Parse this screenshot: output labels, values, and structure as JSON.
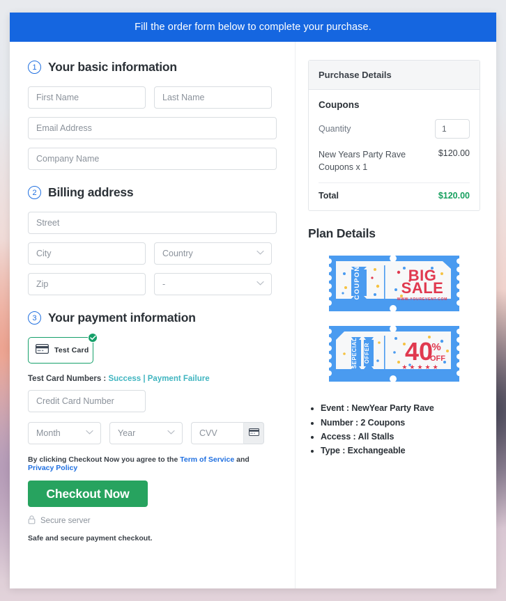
{
  "banner": {
    "text": "Fill the order form below to complete your purchase."
  },
  "sections": {
    "basic": {
      "number": "1",
      "title": "Your basic information",
      "fields": {
        "first_name": "First Name",
        "last_name": "Last Name",
        "email": "Email Address",
        "company": "Company Name"
      }
    },
    "billing": {
      "number": "2",
      "title": "Billing address",
      "fields": {
        "street": "Street",
        "city": "City",
        "country": "Country",
        "zip": "Zip",
        "state": "-"
      }
    },
    "payment": {
      "number": "3",
      "title": "Your payment information",
      "method": {
        "label": "Test  Card",
        "selected": true,
        "icon": "credit-card-icon",
        "check_icon": "check-circle-icon"
      },
      "test_numbers": {
        "prefix": "Test Card Numbers : ",
        "success": "Success",
        "separator": " | ",
        "failure": "Payment Failure"
      },
      "fields": {
        "card_number": "Credit Card Number",
        "month": "Month",
        "year": "Year",
        "cvv": "CVV"
      },
      "cvv_icon": "credit-card-icon",
      "terms": {
        "before": "By clicking Checkout Now you agree to the ",
        "tos": "Term of Service",
        "middle": " and ",
        "privacy": "Privacy Policy"
      },
      "checkout_label": "Checkout Now",
      "secure_label": "Secure server",
      "secure_icon": "lock-icon",
      "safe_note": "Safe and secure payment checkout."
    }
  },
  "purchase_details": {
    "heading": "Purchase Details",
    "subheading": "Coupons",
    "quantity_label": "Quantity",
    "quantity_value": "1",
    "line_item": {
      "name": "New Years Party Rave Coupons x 1",
      "price": "$120.00"
    },
    "total_label": "Total",
    "total_value": "$120.00"
  },
  "plan_details": {
    "title": "Plan Details",
    "tickets": [
      {
        "tab": "COUPON",
        "headline_top": "BIG",
        "headline_bottom": "SALE",
        "url": "WWW.YOUREVENT.COM"
      },
      {
        "tab_top": "SEPECIAL",
        "tab_bottom": "OFFER",
        "amount": "40",
        "percent": "%",
        "off": "OFF"
      }
    ],
    "bullets": [
      "Event : NewYear Party Rave",
      "Number : 2 Coupons",
      "Access : All Stalls",
      "Type : Exchangeable"
    ]
  },
  "colors": {
    "banner_blue": "#1566e0",
    "accent_blue": "#1f6fe0",
    "success_green": "#27a35f",
    "total_green": "#17a05f",
    "test_link_teal": "#40b5c0",
    "ticket_blue": "#4a9bf0",
    "ticket_red": "#e0394f"
  }
}
